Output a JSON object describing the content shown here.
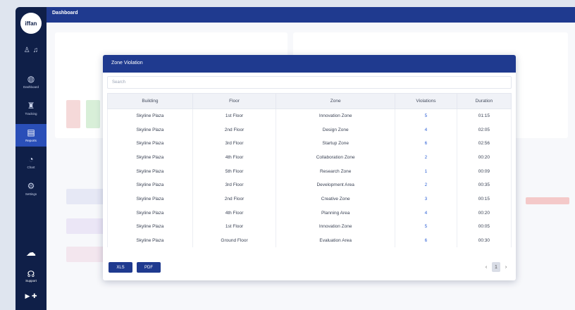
{
  "app": {
    "logo_text": "iffan",
    "page_title": "Dashboard"
  },
  "sidebar": {
    "top_icons": [
      "user-icon",
      "bell-icon"
    ],
    "items": [
      {
        "label": "Dashboard",
        "icon": "dashboard-icon",
        "glyph": "◍"
      },
      {
        "label": "Tracking",
        "icon": "tracking-icon",
        "glyph": "♜"
      },
      {
        "label": "Reports",
        "icon": "reports-icon",
        "glyph": "▤",
        "active": true
      },
      {
        "label": "Chart",
        "icon": "chart-icon",
        "glyph": "◔"
      },
      {
        "label": "Settings",
        "icon": "settings-icon",
        "glyph": "⚙"
      }
    ],
    "bottom": {
      "cloud_glyph": "☁",
      "support_glyph": "☊",
      "support_label": "Support",
      "store_glyphs": "▶ ✚"
    }
  },
  "modal": {
    "title": "Zone Violation",
    "search_placeholder": "Search",
    "columns": [
      "Building",
      "Floor",
      "Zone",
      "Violations",
      "Duration"
    ],
    "rows": [
      [
        "Skyline Plaza",
        "1st Floor",
        "Innovation Zone",
        "5",
        "01:15"
      ],
      [
        "Skyline Plaza",
        "2nd Floor",
        "Design Zone",
        "4",
        "02:05"
      ],
      [
        "Skyline Plaza",
        "3rd Floor",
        "Startup Zone",
        "6",
        "02:56"
      ],
      [
        "Skyline Plaza",
        "4th Floor",
        "Collaboration Zone",
        "2",
        "00:20"
      ],
      [
        "Skyline Plaza",
        "5th Floor",
        "Research Zone",
        "1",
        "00:09"
      ],
      [
        "Skyline Plaza",
        "3rd Floor",
        "Development Area",
        "2",
        "00:35"
      ],
      [
        "Skyline Plaza",
        "2nd Floor",
        "Creative Zone",
        "3",
        "00:15"
      ],
      [
        "Skyline Plaza",
        "4th Floor",
        "Planning Area",
        "4",
        "00:20"
      ],
      [
        "Skyline Plaza",
        "1st Floor",
        "Innovation Zone",
        "5",
        "00:05"
      ],
      [
        "Skyline Plaza",
        "Ground Floor",
        "Evaluation Area",
        "6",
        "00:30"
      ]
    ],
    "export_xls": "XLS",
    "export_pdf": "PDF",
    "pager": {
      "prev": "‹",
      "current": "1",
      "next": "›"
    }
  },
  "colors": {
    "navy": "#0f1f48",
    "header_blue": "#1f3a8f",
    "active_blue": "#2a4fb8",
    "link_blue": "#2f62d6"
  }
}
